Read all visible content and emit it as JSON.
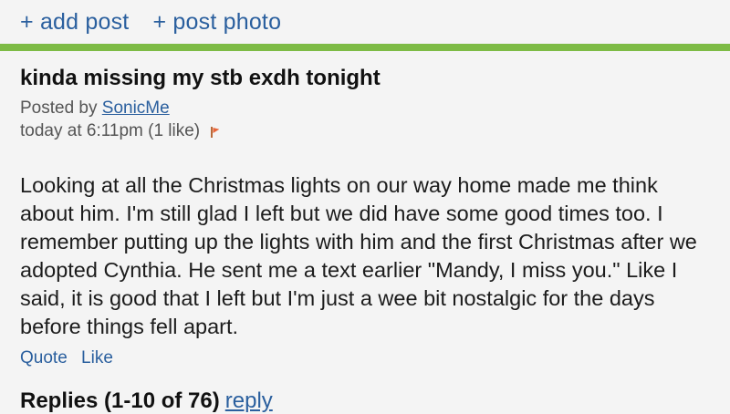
{
  "topbar": {
    "add_post": "+ add post",
    "post_photo": "+ post photo"
  },
  "post": {
    "title": "kinda missing my stb exdh tonight",
    "posted_by_prefix": "Posted by",
    "author": "SonicMe",
    "timestamp": "today at 6:11pm (1 like)",
    "body": "Looking at all the Christmas lights on our way home made me think about him. I'm still glad I left but we did have some good times too. I remember putting up the lights with him and the first Christmas after we adopted Cynthia. He sent me a text earlier \"Mandy, I miss you.\" Like I said, it is good that I left but I'm just a wee bit nostalgic for the days before things fell apart.",
    "quote_label": "Quote",
    "like_label": "Like"
  },
  "replies": {
    "label": "Replies (1-10 of 76)",
    "reply_link": "reply"
  },
  "colors": {
    "accent_bar": "#7dbb45",
    "link": "#2a5f9e",
    "flag": "#e8663a"
  },
  "icons": {
    "flag": "flag-icon"
  }
}
